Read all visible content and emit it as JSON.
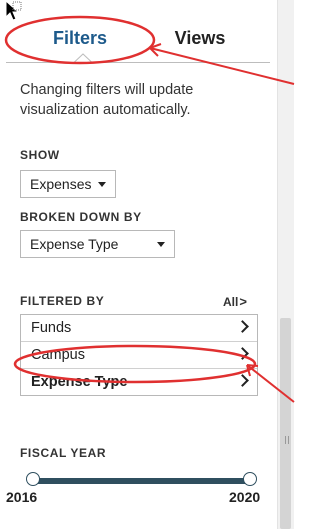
{
  "tabs": {
    "filters_label": "Filters",
    "views_label": "Views"
  },
  "info_text": "Changing filters will update visualization automatically.",
  "show": {
    "label": "SHOW",
    "value": "Expenses"
  },
  "broken_down_by": {
    "label": "BROKEN DOWN BY",
    "value": "Expense Type"
  },
  "filtered_by": {
    "label": "FILTERED BY",
    "all_label": "All",
    "items": [
      {
        "label": "Funds"
      },
      {
        "label": "Campus"
      },
      {
        "label": "Expense Type"
      }
    ]
  },
  "fiscal_year": {
    "label": "FISCAL YEAR",
    "min": "2016",
    "max": "2020"
  },
  "colors": {
    "accent": "#1d5a8b",
    "annotation": "#e03030",
    "slider": "#2f4f5f"
  },
  "icons": [
    "mouse-pointer-icon",
    "chevron-down-icon",
    "chevron-right-icon",
    "annotation-arrow"
  ]
}
